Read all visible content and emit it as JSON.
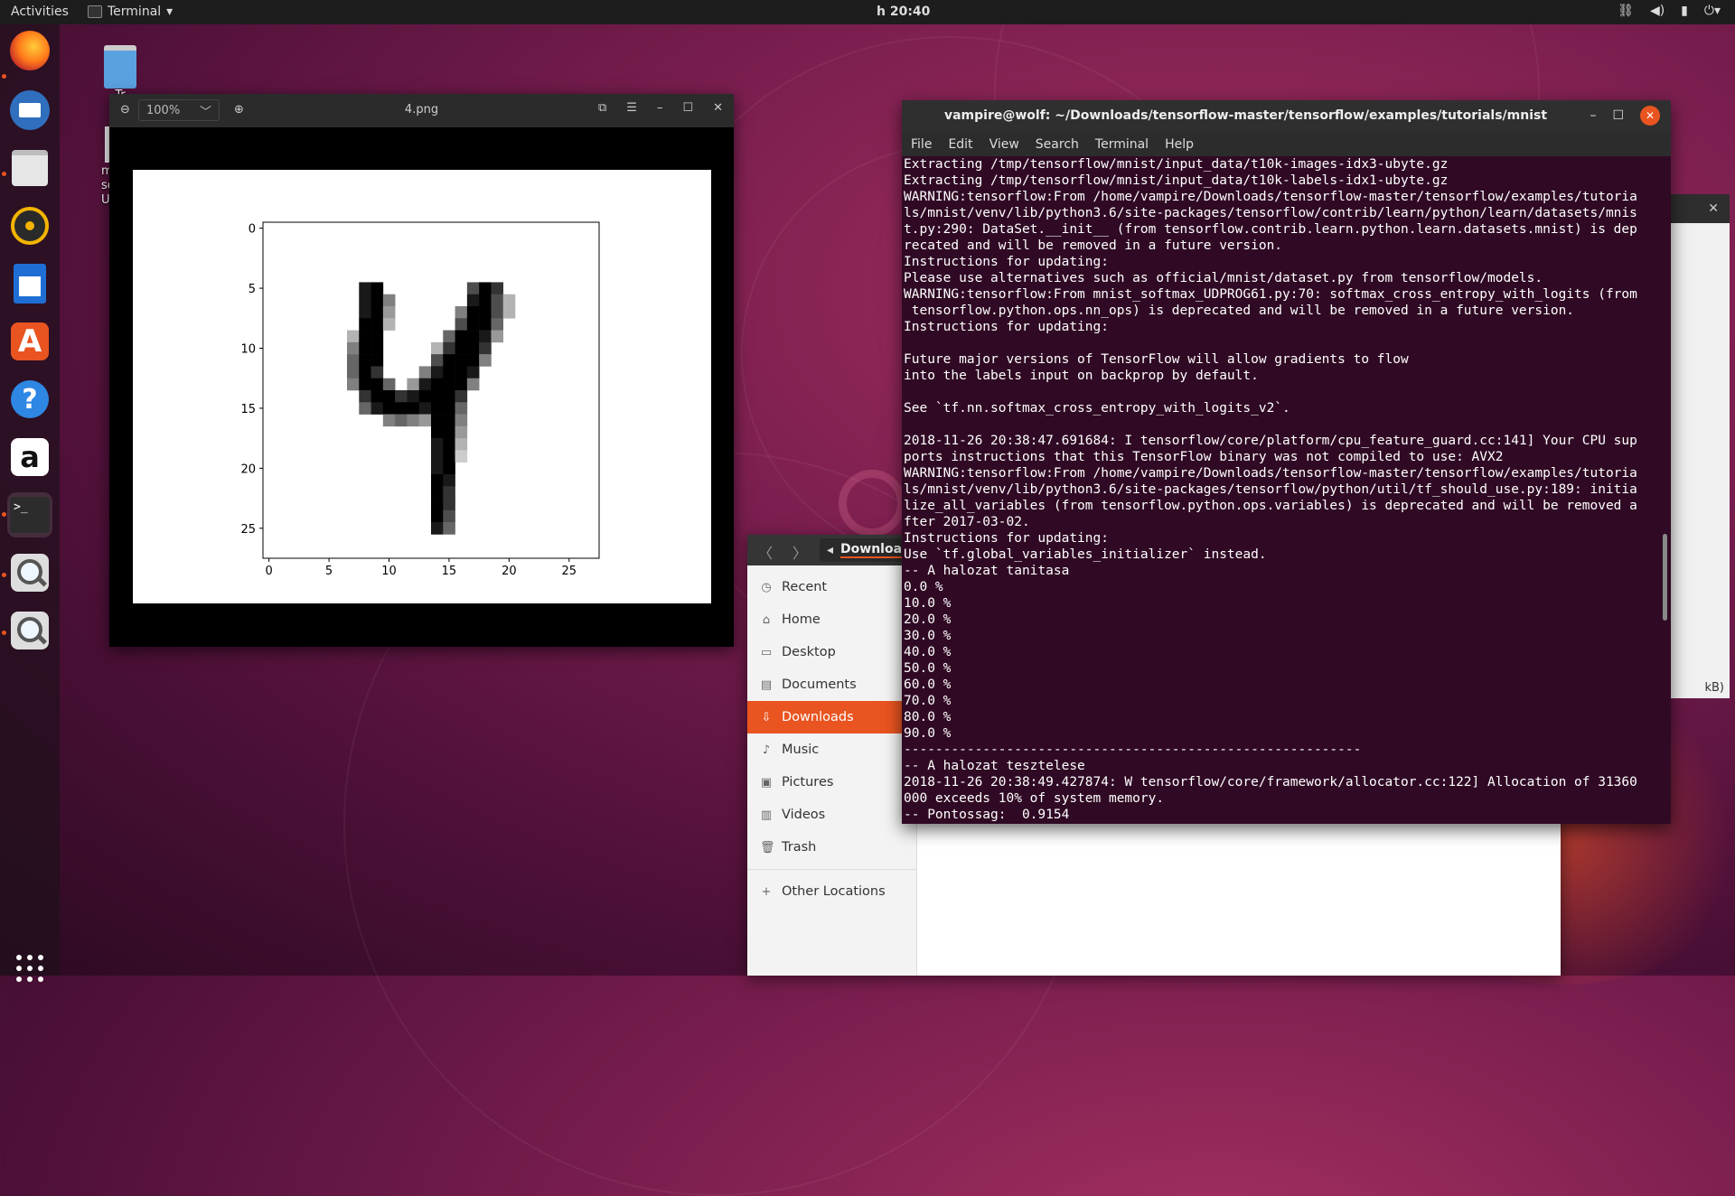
{
  "topbar": {
    "activities": "Activities",
    "app_name": "Terminal",
    "clock": "h 20:40",
    "tray_icons": [
      "network-icon",
      "volume-icon",
      "battery-icon",
      "power-menu-icon"
    ]
  },
  "dock": {
    "items": [
      {
        "name": "firefox",
        "icon": "firefox-icon"
      },
      {
        "name": "thunderbird",
        "icon": "mail-icon"
      },
      {
        "name": "files",
        "icon": "folder-icon"
      },
      {
        "name": "rhythmbox",
        "icon": "music-icon"
      },
      {
        "name": "writer",
        "icon": "document-icon"
      },
      {
        "name": "software",
        "icon": "store-icon",
        "glyph": "A"
      },
      {
        "name": "help",
        "icon": "help-icon",
        "glyph": "?"
      },
      {
        "name": "amazon",
        "icon": "amazon-icon",
        "glyph": "a"
      },
      {
        "name": "terminal",
        "icon": "terminal-icon",
        "glyph": ">_"
      },
      {
        "name": "image-viewer",
        "icon": "magnifier-icon"
      },
      {
        "name": "image-viewer-2",
        "icon": "magnifier-icon"
      }
    ],
    "show_apps": "grid-icon"
  },
  "desktop": {
    "trash_label": "Tr",
    "file_label_lines": [
      "m",
      "sof",
      "UDP"
    ]
  },
  "viewer": {
    "title": "4.png",
    "zoom": "100%",
    "chart_data": {
      "type": "heatmap",
      "title": "",
      "xlabel": "",
      "ylabel": "",
      "x_ticks": [
        "0",
        "5",
        "10",
        "15",
        "20",
        "25"
      ],
      "y_ticks": [
        "0",
        "5",
        "10",
        "15",
        "20",
        "25"
      ],
      "xlim": [
        -0.5,
        27.5
      ],
      "ylim": [
        27.5,
        -0.5
      ],
      "colormap": "gray_r",
      "grid_size": [
        28,
        28
      ],
      "nonzero_pixels": [
        [
          5,
          8,
          0.9
        ],
        [
          5,
          9,
          1
        ],
        [
          5,
          17,
          0.7
        ],
        [
          5,
          18,
          1
        ],
        [
          5,
          19,
          0.8
        ],
        [
          6,
          8,
          0.9
        ],
        [
          6,
          9,
          1
        ],
        [
          6,
          10,
          0.5
        ],
        [
          6,
          17,
          0.9
        ],
        [
          6,
          18,
          1
        ],
        [
          6,
          19,
          0.7
        ],
        [
          6,
          20,
          0.3
        ],
        [
          7,
          8,
          0.9
        ],
        [
          7,
          9,
          1
        ],
        [
          7,
          10,
          0.4
        ],
        [
          7,
          16,
          0.5
        ],
        [
          7,
          17,
          1
        ],
        [
          7,
          18,
          1
        ],
        [
          7,
          19,
          0.7
        ],
        [
          7,
          20,
          0.3
        ],
        [
          8,
          8,
          1
        ],
        [
          8,
          9,
          1
        ],
        [
          8,
          10,
          0.3
        ],
        [
          8,
          16,
          0.7
        ],
        [
          8,
          17,
          1
        ],
        [
          8,
          18,
          1
        ],
        [
          8,
          19,
          0.6
        ],
        [
          9,
          7,
          0.3
        ],
        [
          9,
          8,
          1
        ],
        [
          9,
          9,
          1
        ],
        [
          9,
          15,
          0.6
        ],
        [
          9,
          16,
          1
        ],
        [
          9,
          17,
          1
        ],
        [
          9,
          18,
          0.9
        ],
        [
          9,
          19,
          0.4
        ],
        [
          10,
          7,
          0.5
        ],
        [
          10,
          8,
          1
        ],
        [
          10,
          9,
          1
        ],
        [
          10,
          14,
          0.3
        ],
        [
          10,
          15,
          0.8
        ],
        [
          10,
          16,
          1
        ],
        [
          10,
          17,
          1
        ],
        [
          10,
          18,
          0.8
        ],
        [
          11,
          7,
          0.6
        ],
        [
          11,
          8,
          1
        ],
        [
          11,
          9,
          1
        ],
        [
          11,
          14,
          0.7
        ],
        [
          11,
          15,
          1
        ],
        [
          11,
          16,
          1
        ],
        [
          11,
          17,
          1
        ],
        [
          11,
          18,
          0.5
        ],
        [
          12,
          7,
          0.6
        ],
        [
          12,
          8,
          1
        ],
        [
          12,
          9,
          0.8
        ],
        [
          12,
          13,
          0.5
        ],
        [
          12,
          14,
          0.9
        ],
        [
          12,
          15,
          1
        ],
        [
          12,
          16,
          1
        ],
        [
          12,
          17,
          0.9
        ],
        [
          13,
          7,
          0.5
        ],
        [
          13,
          8,
          1
        ],
        [
          13,
          9,
          1
        ],
        [
          13,
          10,
          0.6
        ],
        [
          13,
          12,
          0.4
        ],
        [
          13,
          13,
          0.9
        ],
        [
          13,
          14,
          1
        ],
        [
          13,
          15,
          1
        ],
        [
          13,
          16,
          1
        ],
        [
          13,
          17,
          0.5
        ],
        [
          14,
          8,
          0.8
        ],
        [
          14,
          9,
          1
        ],
        [
          14,
          10,
          1
        ],
        [
          14,
          11,
          0.8
        ],
        [
          14,
          12,
          0.9
        ],
        [
          14,
          13,
          1
        ],
        [
          14,
          14,
          1
        ],
        [
          14,
          15,
          1
        ],
        [
          14,
          16,
          0.8
        ],
        [
          15,
          8,
          0.6
        ],
        [
          15,
          9,
          0.9
        ],
        [
          15,
          10,
          1
        ],
        [
          15,
          11,
          1
        ],
        [
          15,
          12,
          1
        ],
        [
          15,
          13,
          0.9
        ],
        [
          15,
          14,
          1
        ],
        [
          15,
          15,
          1
        ],
        [
          15,
          16,
          0.6
        ],
        [
          16,
          10,
          0.5
        ],
        [
          16,
          11,
          0.6
        ],
        [
          16,
          12,
          0.5
        ],
        [
          16,
          13,
          0.4
        ],
        [
          16,
          14,
          1
        ],
        [
          16,
          15,
          1
        ],
        [
          16,
          16,
          0.5
        ],
        [
          17,
          14,
          1
        ],
        [
          17,
          15,
          1
        ],
        [
          17,
          16,
          0.4
        ],
        [
          18,
          14,
          0.9
        ],
        [
          18,
          15,
          1
        ],
        [
          18,
          16,
          0.3
        ],
        [
          19,
          14,
          0.9
        ],
        [
          19,
          15,
          1
        ],
        [
          19,
          16,
          0.2
        ],
        [
          20,
          14,
          0.9
        ],
        [
          20,
          15,
          1
        ],
        [
          21,
          14,
          1
        ],
        [
          21,
          15,
          0.9
        ],
        [
          22,
          14,
          1
        ],
        [
          22,
          15,
          0.8
        ],
        [
          23,
          14,
          1
        ],
        [
          23,
          15,
          0.8
        ],
        [
          24,
          14,
          1
        ],
        [
          24,
          15,
          0.7
        ],
        [
          25,
          14,
          0.9
        ],
        [
          25,
          15,
          0.6
        ]
      ]
    }
  },
  "files": {
    "path_crumb": "Downloa",
    "sidebar": [
      {
        "label": "Recent",
        "icon": "clock-icon",
        "glyph": "◷"
      },
      {
        "label": "Home",
        "icon": "home-icon",
        "glyph": "⌂"
      },
      {
        "label": "Desktop",
        "icon": "desktop-icon",
        "glyph": "▭"
      },
      {
        "label": "Documents",
        "icon": "documents-icon",
        "glyph": "▤"
      },
      {
        "label": "Downloads",
        "icon": "download-icon",
        "glyph": "⇩",
        "selected": true
      },
      {
        "label": "Music",
        "icon": "music-note-icon",
        "glyph": "♪"
      },
      {
        "label": "Pictures",
        "icon": "pictures-icon",
        "glyph": "▣"
      },
      {
        "label": "Videos",
        "icon": "videos-icon",
        "glyph": "▥"
      },
      {
        "label": "Trash",
        "icon": "trash-icon",
        "glyph": "🗑"
      },
      {
        "label": "Other Locations",
        "icon": "plus-icon",
        "glyph": "+"
      }
    ]
  },
  "background_dialog": {
    "close": "✕",
    "footer": "kB)"
  },
  "terminal": {
    "title": "vampire@wolf: ~/Downloads/tensorflow-master/tensorflow/examples/tutorials/mnist",
    "menu": [
      "File",
      "Edit",
      "View",
      "Search",
      "Terminal",
      "Help"
    ],
    "lines": [
      "Extracting /tmp/tensorflow/mnist/input_data/t10k-images-idx3-ubyte.gz",
      "Extracting /tmp/tensorflow/mnist/input_data/t10k-labels-idx1-ubyte.gz",
      "WARNING:tensorflow:From /home/vampire/Downloads/tensorflow-master/tensorflow/examples/tutoria",
      "ls/mnist/venv/lib/python3.6/site-packages/tensorflow/contrib/learn/python/learn/datasets/mnis",
      "t.py:290: DataSet.__init__ (from tensorflow.contrib.learn.python.learn.datasets.mnist) is dep",
      "recated and will be removed in a future version.",
      "Instructions for updating:",
      "Please use alternatives such as official/mnist/dataset.py from tensorflow/models.",
      "WARNING:tensorflow:From mnist_softmax_UDPROG61.py:70: softmax_cross_entropy_with_logits (from",
      " tensorflow.python.ops.nn_ops) is deprecated and will be removed in a future version.",
      "Instructions for updating:",
      "",
      "Future major versions of TensorFlow will allow gradients to flow",
      "into the labels input on backprop by default.",
      "",
      "See `tf.nn.softmax_cross_entropy_with_logits_v2`.",
      "",
      "2018-11-26 20:38:47.691684: I tensorflow/core/platform/cpu_feature_guard.cc:141] Your CPU sup",
      "ports instructions that this TensorFlow binary was not compiled to use: AVX2",
      "WARNING:tensorflow:From /home/vampire/Downloads/tensorflow-master/tensorflow/examples/tutoria",
      "ls/mnist/venv/lib/python3.6/site-packages/tensorflow/python/util/tf_should_use.py:189: initia",
      "lize_all_variables (from tensorflow.python.ops.variables) is deprecated and will be removed a",
      "fter 2017-03-02.",
      "Instructions for updating:",
      "Use `tf.global_variables_initializer` instead.",
      "-- A halozat tanitasa",
      "0.0 %",
      "10.0 %",
      "20.0 %",
      "30.0 %",
      "40.0 %",
      "50.0 %",
      "60.0 %",
      "70.0 %",
      "80.0 %",
      "90.0 %",
      "----------------------------------------------------------",
      "-- A halozat tesztelese",
      "2018-11-26 20:38:49.427874: W tensorflow/core/framework/allocator.cc:122] Allocation of 31360",
      "000 exceeds 10% of system memory.",
      "-- Pontossag:  0.9154"
    ]
  }
}
